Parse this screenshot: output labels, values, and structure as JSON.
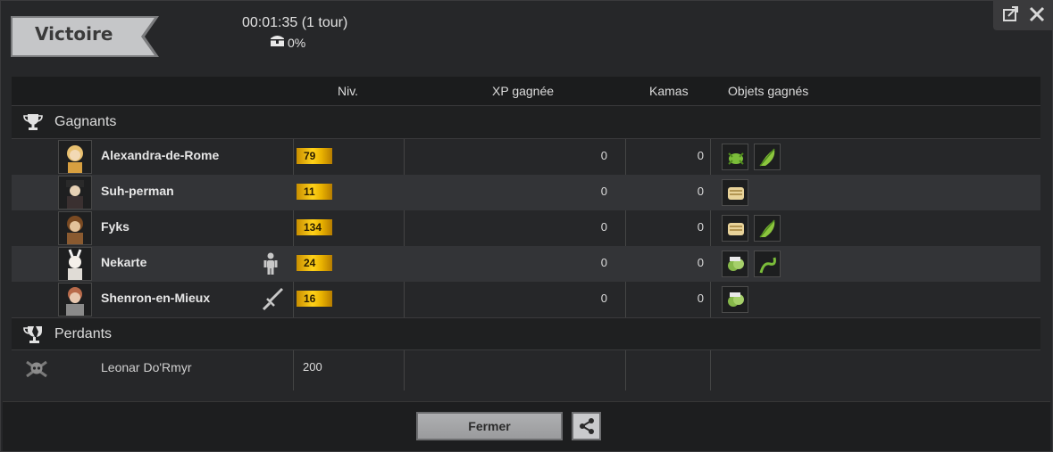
{
  "banner": {
    "label": "Victoire"
  },
  "fight": {
    "duration": "00:01:35 (1 tour)",
    "chest_percent": "0%"
  },
  "columns": {
    "level": "Niv.",
    "xp": "XP gagnée",
    "kamas": "Kamas",
    "items": "Objets gagnés"
  },
  "winners": {
    "title": "Gagnants",
    "rows": [
      {
        "name": "Alexandra-de-Rome",
        "level": "79",
        "xp": "0",
        "kamas": "0",
        "items": [
          "green-insect-item-icon",
          "green-leaf-item-icon"
        ],
        "role": ""
      },
      {
        "name": "Suh-perman",
        "level": "11",
        "xp": "0",
        "kamas": "0",
        "items": [
          "scroll-item-icon"
        ],
        "role": ""
      },
      {
        "name": "Fyks",
        "level": "134",
        "xp": "0",
        "kamas": "0",
        "items": [
          "scroll-item-icon",
          "green-leaf-item-icon"
        ],
        "role": ""
      },
      {
        "name": "Nekarte",
        "level": "24",
        "xp": "0",
        "kamas": "0",
        "items": [
          "plant-bundle-item-icon",
          "vine-item-icon"
        ],
        "role": "person-icon"
      },
      {
        "name": "Shenron-en-Mieux",
        "level": "16",
        "xp": "0",
        "kamas": "0",
        "items": [
          "plant-bundle-item-icon"
        ],
        "role": "sword-icon"
      }
    ]
  },
  "losers": {
    "title": "Perdants",
    "rows": [
      {
        "name": "Leonar Do'Rmyr",
        "level": "200"
      }
    ]
  },
  "footer": {
    "close_label": "Fermer"
  },
  "colors": {
    "level_gold": "#ffd21a",
    "background": "#262729",
    "row_alt": "#333437"
  }
}
